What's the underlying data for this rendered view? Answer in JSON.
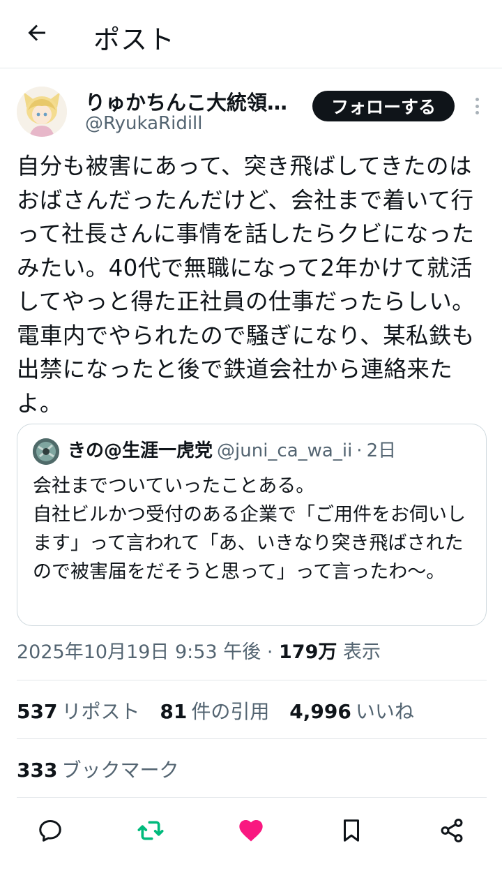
{
  "header": {
    "title": "ポスト",
    "back_icon": "arrow-left-icon"
  },
  "author": {
    "display_name": "りゅかちんこ大統領…",
    "handle": "@RyukaRidill",
    "follow_label": "フォローする"
  },
  "post": {
    "text": "自分も被害にあって、突き飛ばしてきたのはおばさんだったんだけど、会社まで着いて行って社長さんに事情を話したらクビになったみたい。40代で無職になって2年かけて就活してやっと得た正社員の仕事だったらしい。電車内でやられたので騒ぎになり、某私鉄も出禁になったと後で鉄道会社から連絡来たよ。"
  },
  "quote": {
    "name": "きの@生涯一虎党",
    "handle": "@juni_ca_wa_ii",
    "separator": "·",
    "age": "2日",
    "text": "会社までついていったことある。\n自社ビルかつ受付のある企業で「ご用件をお伺いします」って言われて「あ、いきなり突き飛ばされたので被害届をだそうと思って」って言ったわ〜。"
  },
  "meta": {
    "date": "2025年10月19日 9:53 午後",
    "separator": "·",
    "views_count": "179万",
    "views_label": "表示"
  },
  "stats": {
    "reposts_count": "537",
    "reposts_label": "リポスト",
    "quotes_count": "81",
    "quotes_label": "件の引用",
    "likes_count": "4,996",
    "likes_label": "いいね",
    "bookmarks_count": "333",
    "bookmarks_label": "ブックマーク"
  },
  "actions": {
    "reply_icon": "reply-icon",
    "repost_icon": "repost-icon",
    "like_icon": "heart-icon",
    "bookmark_icon": "bookmark-icon",
    "share_icon": "share-icon"
  },
  "colors": {
    "text": "#0f1419",
    "secondary": "#536471",
    "repost_active": "#00ba7c",
    "like_active": "#f91880",
    "follow_button": "#0f1419"
  }
}
